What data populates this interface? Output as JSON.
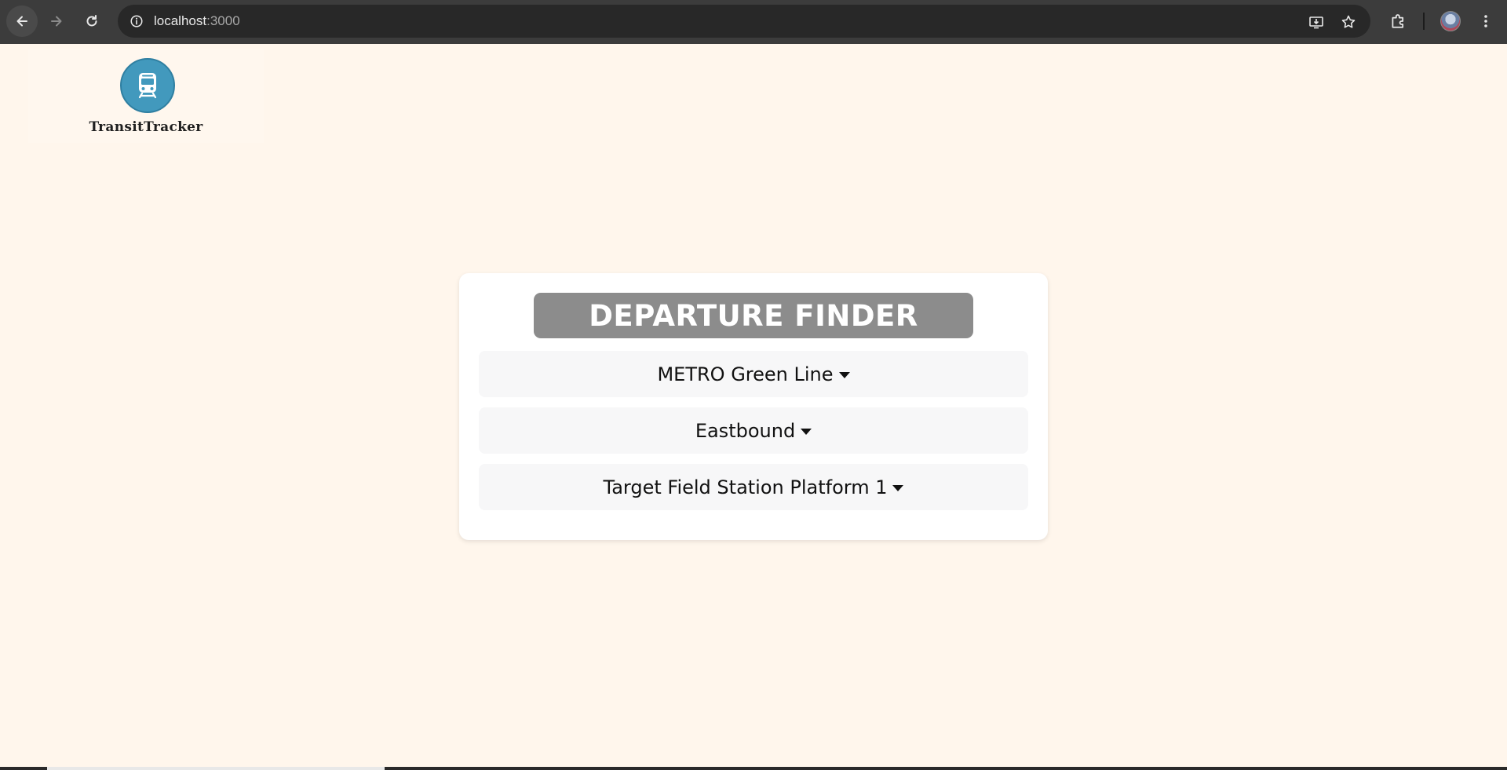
{
  "browser": {
    "url_host": "localhost",
    "url_port": ":3000"
  },
  "logo": {
    "text": "TransitTracker",
    "icon": "train-icon",
    "color": "#4299bd"
  },
  "card": {
    "title": "DEPARTURE FINDER",
    "route_select": "METRO Green Line",
    "direction_select": "Eastbound",
    "stop_select": "Target Field Station Platform 1"
  },
  "colors": {
    "background": "#fff6ec",
    "title_bg": "#8c8c8c",
    "select_bg": "#f7f7f8"
  }
}
